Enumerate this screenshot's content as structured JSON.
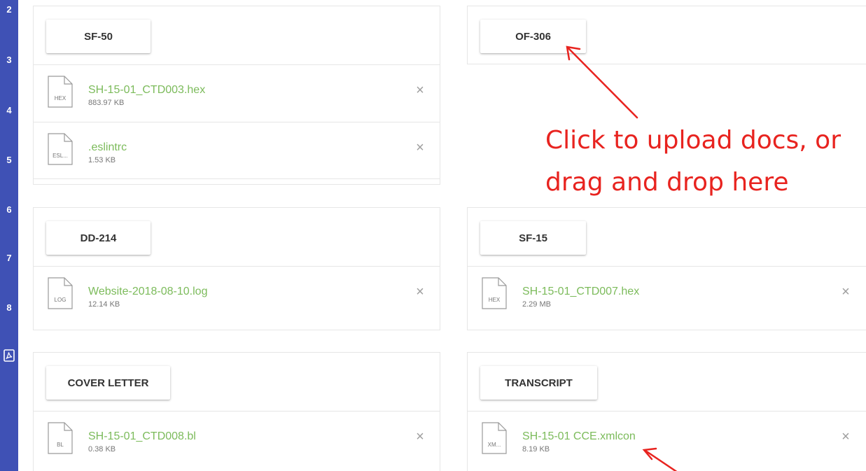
{
  "step_rail": {
    "numbers": [
      "2",
      "3",
      "4",
      "5",
      "6",
      "7",
      "8"
    ]
  },
  "panels": {
    "sf50": {
      "label": "SF-50",
      "files": [
        {
          "name": "SH-15-01_CTD003.hex",
          "size": "883.97 KB",
          "ext": "HEX"
        },
        {
          "name": ".eslintrc",
          "size": "1.53 KB",
          "ext": "ESL..."
        }
      ]
    },
    "of306": {
      "label": "OF-306",
      "files": []
    },
    "dd214": {
      "label": "DD-214",
      "files": [
        {
          "name": "Website-2018-08-10.log",
          "size": "12.14 KB",
          "ext": "LOG"
        }
      ]
    },
    "sf15": {
      "label": "SF-15",
      "files": [
        {
          "name": "SH-15-01_CTD007.hex",
          "size": "2.29 MB",
          "ext": "HEX"
        }
      ]
    },
    "cover_letter": {
      "label": "COVER LETTER",
      "files": [
        {
          "name": "SH-15-01_CTD008.bl",
          "size": "0.38 KB",
          "ext": "BL"
        }
      ]
    },
    "transcript": {
      "label": "TRANSCRIPT",
      "files": [
        {
          "name": "SH-15-01 CCE.xmlcon",
          "size": "8.19 KB",
          "ext": "XM..."
        }
      ]
    }
  },
  "remove_symbol": "×",
  "annotation": {
    "line1": "Click to upload docs, or",
    "line2": "drag and drop here",
    "color": "#e8231f"
  },
  "colors": {
    "rail": "#3f51b5",
    "file_name": "#7cbb5b",
    "border": "#e6e6e6"
  }
}
